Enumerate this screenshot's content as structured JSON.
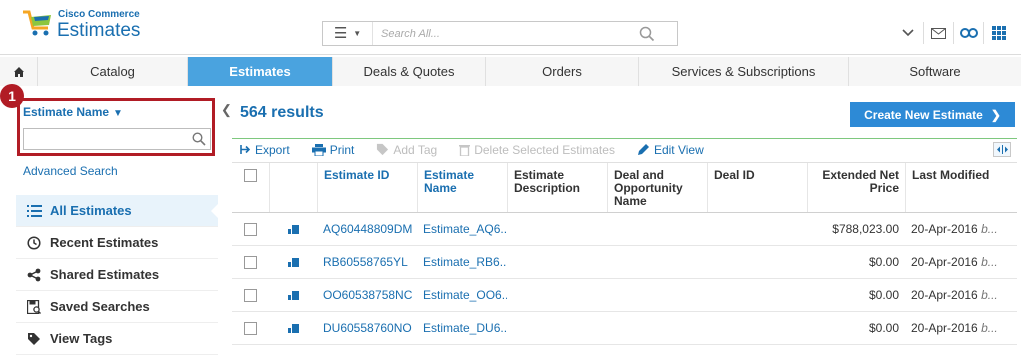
{
  "header": {
    "brand_small": "Cisco Commerce",
    "brand_title": "Estimates",
    "search_placeholder": "Search All...",
    "icons": [
      "chevron-down-icon",
      "mail-icon",
      "link-icon",
      "grid-icon"
    ]
  },
  "tabs": [
    {
      "label": "Catalog"
    },
    {
      "label": "Estimates",
      "active": true
    },
    {
      "label": "Deals & Quotes"
    },
    {
      "label": "Orders"
    },
    {
      "label": "Services & Subscriptions"
    },
    {
      "label": "Software"
    }
  ],
  "sidebar": {
    "filter_label": "Estimate Name",
    "filter_value": "",
    "advanced_search": "Advanced Search",
    "step_badge": "1",
    "items": [
      {
        "label": "All Estimates",
        "icon": "list-icon",
        "active": true
      },
      {
        "label": "Recent Estimates",
        "icon": "clock-icon"
      },
      {
        "label": "Shared Estimates",
        "icon": "share-icon"
      },
      {
        "label": "Saved Searches",
        "icon": "saved-search-icon"
      },
      {
        "label": "View Tags",
        "icon": "tag-icon"
      }
    ]
  },
  "main": {
    "results_count": "564 results",
    "create_button": "Create New Estimate",
    "toolbar": {
      "export": "Export",
      "print": "Print",
      "add_tag": "Add Tag",
      "delete": "Delete Selected Estimates",
      "edit_view": "Edit View"
    },
    "columns": {
      "estimate_id": "Estimate ID",
      "estimate_name": "Estimate Name",
      "description": "Estimate Description",
      "deal_name": "Deal and Opportunity Name",
      "deal_id": "Deal ID",
      "price": "Extended Net Price",
      "modified": "Last Modified"
    },
    "rows": [
      {
        "id": "AQ60448809DM",
        "name": "Estimate_AQ6...",
        "description": "",
        "deal_name": "",
        "deal_id": "",
        "price": "$788,023.00",
        "modified": "20-Apr-2016",
        "by": "b..."
      },
      {
        "id": "RB60558765YL",
        "name": "Estimate_RB6...",
        "description": "",
        "deal_name": "",
        "deal_id": "",
        "price": "$0.00",
        "modified": "20-Apr-2016",
        "by": "b..."
      },
      {
        "id": "OO60538758NC",
        "name": "Estimate_OO6...",
        "description": "",
        "deal_name": "",
        "deal_id": "",
        "price": "$0.00",
        "modified": "20-Apr-2016",
        "by": "b..."
      },
      {
        "id": "DU60558760NO",
        "name": "Estimate_DU6...",
        "description": "",
        "deal_name": "",
        "deal_id": "",
        "price": "$0.00",
        "modified": "20-Apr-2016",
        "by": "b..."
      }
    ]
  },
  "colors": {
    "brand_blue": "#1a6fb0",
    "active_tab": "#4aa3df",
    "create_button": "#2d8ad6",
    "highlight_red": "#b11c25",
    "toolbar_rule_green": "#7ec87e"
  }
}
